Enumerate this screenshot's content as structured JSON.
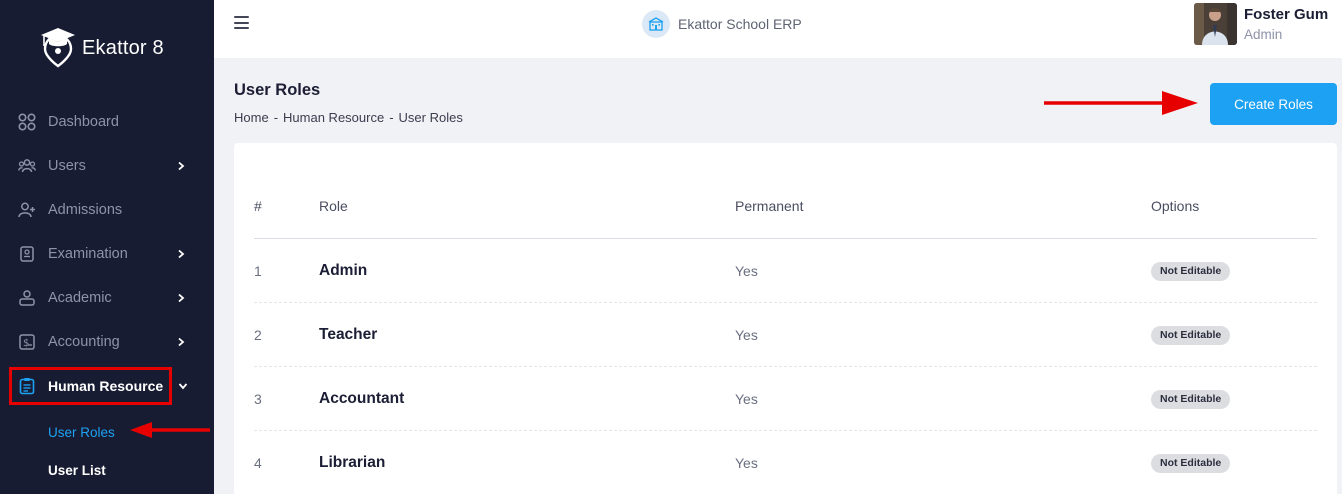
{
  "sidebar": {
    "brand": "Ekattor 8",
    "items": [
      {
        "label": "Dashboard"
      },
      {
        "label": "Users"
      },
      {
        "label": "Admissions"
      },
      {
        "label": "Examination"
      },
      {
        "label": "Academic"
      },
      {
        "label": "Accounting"
      },
      {
        "label": "Human Resource"
      }
    ],
    "subitems": [
      {
        "label": "User Roles"
      },
      {
        "label": "User List"
      }
    ]
  },
  "header": {
    "app_title": "Ekattor School ERP",
    "user_name": "Foster Gum",
    "user_role": "Admin"
  },
  "page": {
    "title": "User Roles",
    "breadcrumb": [
      "Home",
      "Human Resource",
      "User Roles"
    ],
    "create_button": "Create Roles"
  },
  "table": {
    "columns": [
      "#",
      "Role",
      "Permanent",
      "Options"
    ],
    "rows": [
      {
        "num": "1",
        "role": "Admin",
        "permanent": "Yes",
        "option": "Not Editable"
      },
      {
        "num": "2",
        "role": "Teacher",
        "permanent": "Yes",
        "option": "Not Editable"
      },
      {
        "num": "3",
        "role": "Accountant",
        "permanent": "Yes",
        "option": "Not Editable"
      },
      {
        "num": "4",
        "role": "Librarian",
        "permanent": "Yes",
        "option": "Not Editable"
      }
    ]
  },
  "colors": {
    "sidebar_bg": "#181c32",
    "accent": "#1da1f2",
    "annotation_red": "#e60000"
  }
}
